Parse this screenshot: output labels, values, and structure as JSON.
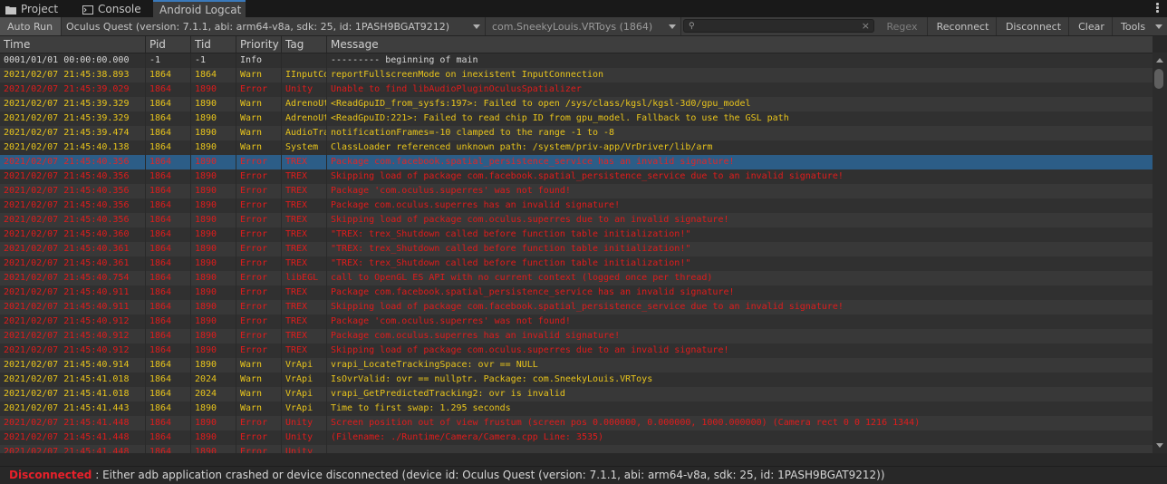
{
  "tabs": [
    {
      "label": "Project",
      "icon": "folder-icon"
    },
    {
      "label": "Console",
      "icon": "console-icon"
    },
    {
      "label": "Android Logcat",
      "icon": ""
    }
  ],
  "toolbar": {
    "auto_run": "Auto Run",
    "device": "Oculus Quest (version: 7.1.1, abi: arm64-v8a, sdk: 25, id: 1PASH9BGAT9212)",
    "package": "com.SneekyLouis.VRToys (1864)",
    "search_value": "",
    "regex": "Regex",
    "reconnect": "Reconnect",
    "disconnect": "Disconnect",
    "clear": "Clear",
    "tools": "Tools"
  },
  "columns": {
    "time": "Time",
    "pid": "Pid",
    "tid": "Tid",
    "priority": "Priority",
    "tag": "Tag",
    "message": "Message"
  },
  "colors": {
    "warn": "#e8c41c",
    "error": "#df1c1c",
    "info": "#d8d8d8",
    "selection": "#2c5d87",
    "accent": "#3a79bb"
  },
  "rows": [
    {
      "time": "0001/01/01 00:00:00.000",
      "pid": "-1",
      "tid": "-1",
      "priority": "Info",
      "tag": "",
      "message": "--------- beginning of main"
    },
    {
      "time": "2021/02/07 21:45:38.893",
      "pid": "1864",
      "tid": "1864",
      "priority": "Warn",
      "tag": "IInputConnection",
      "message": "reportFullscreenMode on inexistent InputConnection"
    },
    {
      "time": "2021/02/07 21:45:39.029",
      "pid": "1864",
      "tid": "1890",
      "priority": "Error",
      "tag": "Unity",
      "message": "Unable to find libAudioPluginOculusSpatializer"
    },
    {
      "time": "2021/02/07 21:45:39.329",
      "pid": "1864",
      "tid": "1890",
      "priority": "Warn",
      "tag": "AdrenoUtils",
      "message": "<ReadGpuID_from_sysfs:197>: Failed to open /sys/class/kgsl/kgsl-3d0/gpu_model"
    },
    {
      "time": "2021/02/07 21:45:39.329",
      "pid": "1864",
      "tid": "1890",
      "priority": "Warn",
      "tag": "AdrenoUtils",
      "message": "<ReadGpuID:221>: Failed to read chip ID from gpu_model. Fallback to use the GSL path"
    },
    {
      "time": "2021/02/07 21:45:39.474",
      "pid": "1864",
      "tid": "1890",
      "priority": "Warn",
      "tag": "AudioTrack",
      "message": "notificationFrames=-10 clamped to the range -1 to -8"
    },
    {
      "time": "2021/02/07 21:45:40.138",
      "pid": "1864",
      "tid": "1890",
      "priority": "Warn",
      "tag": "System",
      "message": "ClassLoader referenced unknown path: /system/priv-app/VrDriver/lib/arm"
    },
    {
      "time": "2021/02/07 21:45:40.356",
      "pid": "1864",
      "tid": "1890",
      "priority": "Error",
      "tag": "TREX",
      "message": "Package com.facebook.spatial_persistence_service has an invalid signature!",
      "selected": true
    },
    {
      "time": "2021/02/07 21:45:40.356",
      "pid": "1864",
      "tid": "1890",
      "priority": "Error",
      "tag": "TREX",
      "message": "Skipping load of package com.facebook.spatial_persistence_service due to an invalid signature!"
    },
    {
      "time": "2021/02/07 21:45:40.356",
      "pid": "1864",
      "tid": "1890",
      "priority": "Error",
      "tag": "TREX",
      "message": "Package 'com.oculus.superres' was not found!"
    },
    {
      "time": "2021/02/07 21:45:40.356",
      "pid": "1864",
      "tid": "1890",
      "priority": "Error",
      "tag": "TREX",
      "message": "Package com.oculus.superres has an invalid signature!"
    },
    {
      "time": "2021/02/07 21:45:40.356",
      "pid": "1864",
      "tid": "1890",
      "priority": "Error",
      "tag": "TREX",
      "message": "Skipping load of package com.oculus.superres due to an invalid signature!"
    },
    {
      "time": "2021/02/07 21:45:40.360",
      "pid": "1864",
      "tid": "1890",
      "priority": "Error",
      "tag": "TREX",
      "message": "\"TREX: trex_Shutdown called before function table initialization!\""
    },
    {
      "time": "2021/02/07 21:45:40.361",
      "pid": "1864",
      "tid": "1890",
      "priority": "Error",
      "tag": "TREX",
      "message": "\"TREX: trex_Shutdown called before function table initialization!\""
    },
    {
      "time": "2021/02/07 21:45:40.361",
      "pid": "1864",
      "tid": "1890",
      "priority": "Error",
      "tag": "TREX",
      "message": "\"TREX: trex_Shutdown called before function table initialization!\""
    },
    {
      "time": "2021/02/07 21:45:40.754",
      "pid": "1864",
      "tid": "1890",
      "priority": "Error",
      "tag": "libEGL",
      "message": "call to OpenGL ES API with no current context (logged once per thread)"
    },
    {
      "time": "2021/02/07 21:45:40.911",
      "pid": "1864",
      "tid": "1890",
      "priority": "Error",
      "tag": "TREX",
      "message": "Package com.facebook.spatial_persistence_service has an invalid signature!"
    },
    {
      "time": "2021/02/07 21:45:40.911",
      "pid": "1864",
      "tid": "1890",
      "priority": "Error",
      "tag": "TREX",
      "message": "Skipping load of package com.facebook.spatial_persistence_service due to an invalid signature!"
    },
    {
      "time": "2021/02/07 21:45:40.912",
      "pid": "1864",
      "tid": "1890",
      "priority": "Error",
      "tag": "TREX",
      "message": "Package 'com.oculus.superres' was not found!"
    },
    {
      "time": "2021/02/07 21:45:40.912",
      "pid": "1864",
      "tid": "1890",
      "priority": "Error",
      "tag": "TREX",
      "message": "Package com.oculus.superres has an invalid signature!"
    },
    {
      "time": "2021/02/07 21:45:40.912",
      "pid": "1864",
      "tid": "1890",
      "priority": "Error",
      "tag": "TREX",
      "message": "Skipping load of package com.oculus.superres due to an invalid signature!"
    },
    {
      "time": "2021/02/07 21:45:40.914",
      "pid": "1864",
      "tid": "1890",
      "priority": "Warn",
      "tag": "VrApi",
      "message": "vrapi_LocateTrackingSpace: ovr == NULL"
    },
    {
      "time": "2021/02/07 21:45:41.018",
      "pid": "1864",
      "tid": "2024",
      "priority": "Warn",
      "tag": "VrApi",
      "message": "IsOvrValid: ovr == nullptr. Package: com.SneekyLouis.VRToys"
    },
    {
      "time": "2021/02/07 21:45:41.018",
      "pid": "1864",
      "tid": "2024",
      "priority": "Warn",
      "tag": "VrApi",
      "message": "vrapi_GetPredictedTracking2: ovr is invalid"
    },
    {
      "time": "2021/02/07 21:45:41.443",
      "pid": "1864",
      "tid": "1890",
      "priority": "Warn",
      "tag": "VrApi",
      "message": "Time to first swap: 1.295 seconds"
    },
    {
      "time": "2021/02/07 21:45:41.448",
      "pid": "1864",
      "tid": "1890",
      "priority": "Error",
      "tag": "Unity",
      "message": "Screen position out of view frustum (screen pos 0.000000, 0.000000, 1000.000000) (Camera rect 0 0 1216 1344)"
    },
    {
      "time": "2021/02/07 21:45:41.448",
      "pid": "1864",
      "tid": "1890",
      "priority": "Error",
      "tag": "Unity",
      "message": "(Filename: ./Runtime/Camera/Camera.cpp Line: 3535)"
    },
    {
      "time": "2021/02/07 21:45:41.448",
      "pid": "1864",
      "tid": "1890",
      "priority": "Error",
      "tag": "Unity",
      "message": ""
    }
  ],
  "status": {
    "keyword": "Disconnected",
    "message": " : Either adb application crashed or device disconnected (device id: Oculus Quest (version: 7.1.1, abi: arm64-v8a, sdk: 25, id: 1PASH9BGAT9212))"
  }
}
